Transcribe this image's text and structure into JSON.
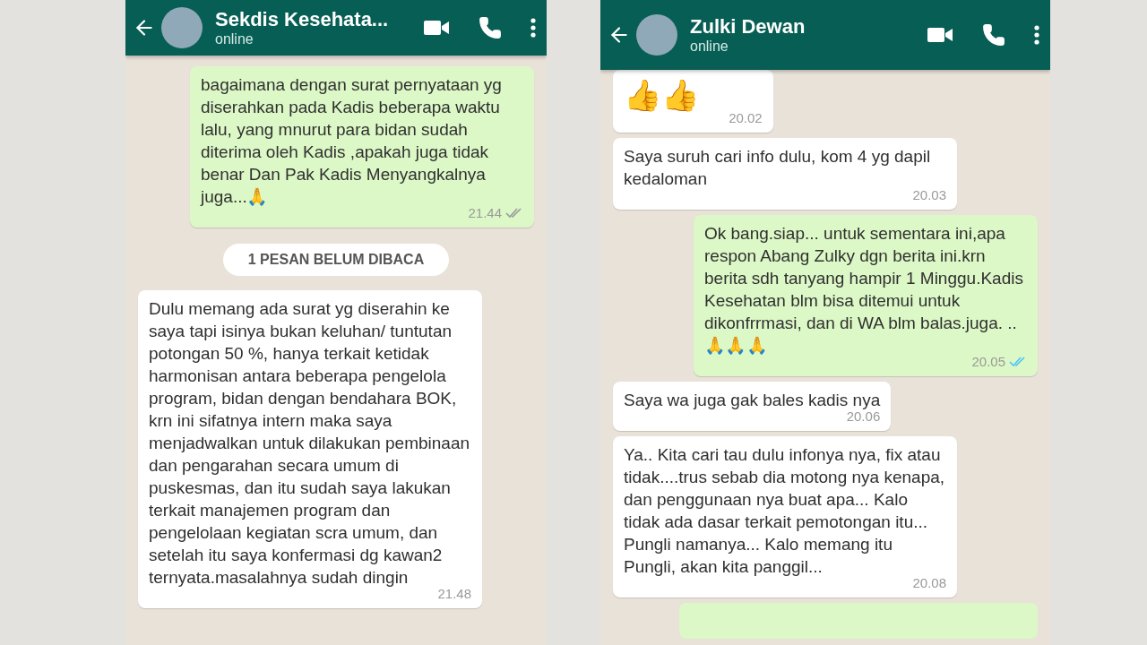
{
  "phones": [
    {
      "contact": {
        "name": "Sekdis Kesehata...",
        "status": "online"
      },
      "messages": [
        {
          "kind": "out",
          "text": "bagaimana dengan surat pernyataan yg diserahkan pada Kadis beberapa waktu lalu, yang mnurut para bidan sudah diterima oleh Kadis ,apakah juga tidak benar Dan Pak Kadis Menyangkalnya juga...🙏",
          "time": "21.44",
          "read": false
        },
        {
          "kind": "divider",
          "text": "1 PESAN BELUM DIBACA"
        },
        {
          "kind": "in",
          "text": "Dulu memang ada surat yg diserahin ke saya tapi isinya bukan keluhan/ tuntutan potongan 50 %, hanya terkait ketidak harmonisan antara beberapa pengelola program, bidan dengan bendahara BOK, krn ini sifatnya intern maka saya menjadwalkan untuk dilakukan pembinaan dan pengarahan secara umum di puskesmas, dan itu sudah saya lakukan terkait manajemen program dan pengelolaan kegiatan scra umum, dan setelah itu saya konfermasi dg kawan2 ternyata.masalahnya sudah dingin",
          "time": "21.48"
        }
      ]
    },
    {
      "contact": {
        "name": "Zulki Dewan",
        "status": "online"
      },
      "messages": [
        {
          "kind": "in-jumbo",
          "text": "👍👍",
          "time": "20.02"
        },
        {
          "kind": "in",
          "text": "Saya suruh cari info dulu, kom 4 yg dapil kedaloman",
          "time": "20.03"
        },
        {
          "kind": "out",
          "text": "Ok bang.siap... untuk sementara ini,apa respon Abang Zulky dgn berita ini.krn berita sdh tanyang hampir 1 Minggu.Kadis Kesehatan blm bisa ditemui untuk dikonfrrmasi, dan di WA blm balas.juga. ..🙏🙏🙏",
          "time": "20.05",
          "read": true
        },
        {
          "kind": "in",
          "text": "Saya wa juga gak bales kadis nya",
          "time": "20.06"
        },
        {
          "kind": "in",
          "text": "Ya.. Kita cari tau dulu infonya nya, fix atau tidak....trus sebab dia motong nya kenapa, dan penggunaan nya buat apa... Kalo tidak ada dasar terkait pemotongan itu... Pungli namanya... Kalo memang itu Pungli, akan kita panggil...",
          "time": "20.08"
        },
        {
          "kind": "cut-off"
        }
      ]
    }
  ]
}
